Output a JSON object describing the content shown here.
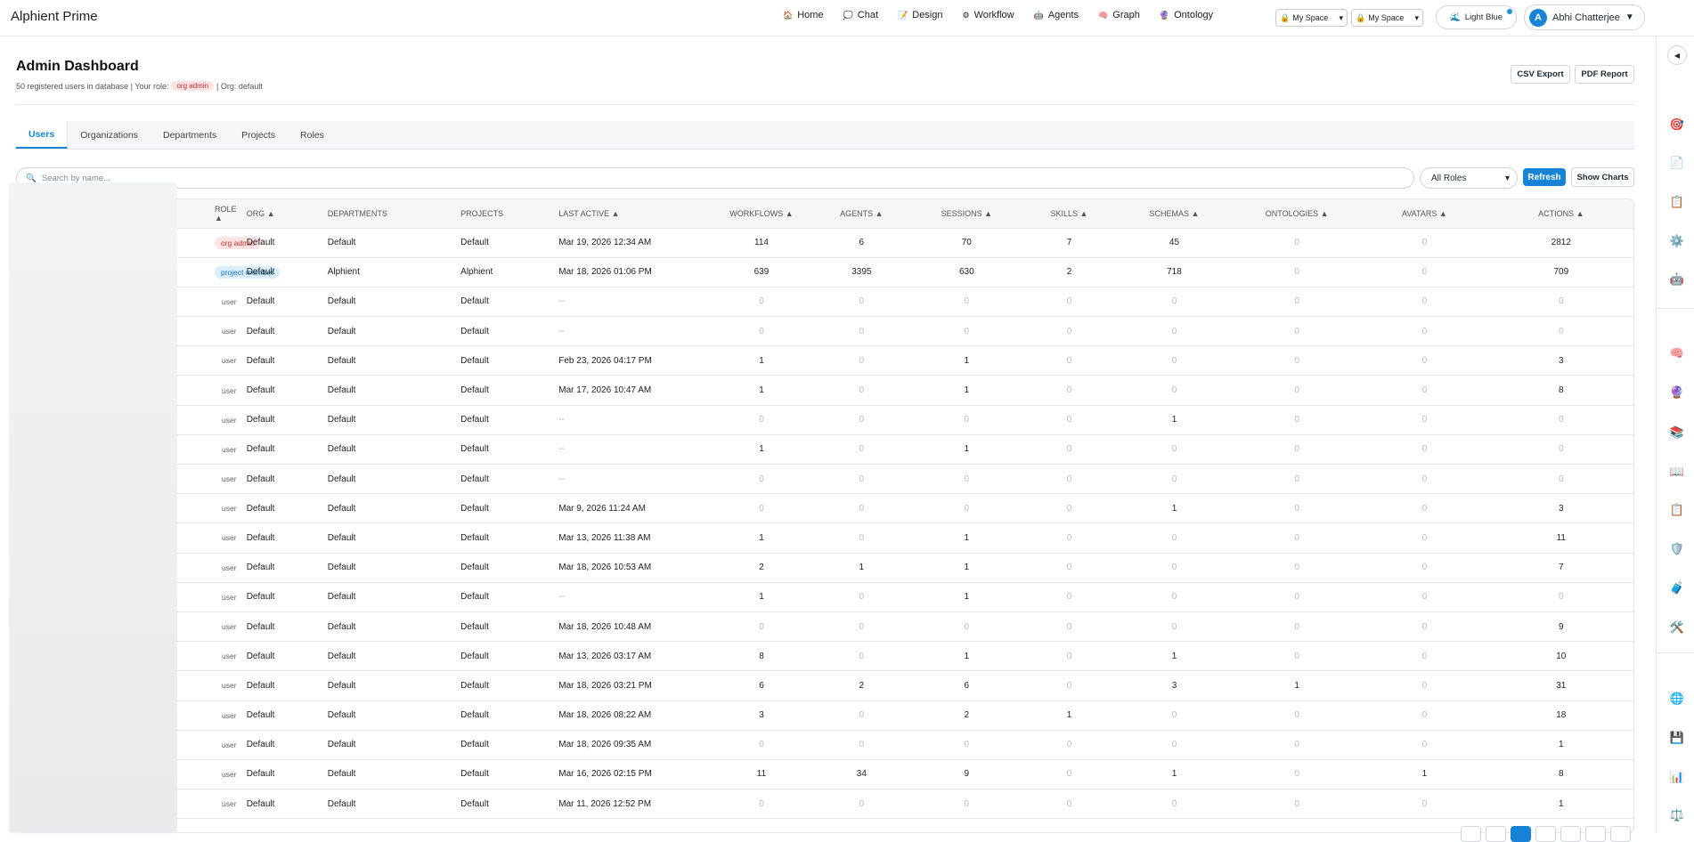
{
  "app": {
    "title": "Alphient Prime"
  },
  "nav": [
    {
      "label": "Home",
      "icon": "🏠"
    },
    {
      "label": "Chat",
      "icon": "💭"
    },
    {
      "label": "Design",
      "icon": "📝"
    },
    {
      "label": "Workflow",
      "icon": "⚙"
    },
    {
      "label": "Agents",
      "icon": "🤖"
    },
    {
      "label": "Graph",
      "icon": "🧠"
    },
    {
      "label": "Ontology",
      "icon": "🔮"
    }
  ],
  "space_selects": [
    {
      "label": "My Space"
    },
    {
      "label": "My Space"
    }
  ],
  "theme": {
    "label": "Light Blue"
  },
  "user": {
    "initial": "A",
    "name": "Abhi Chatterjee"
  },
  "page": {
    "title": "Admin Dashboard",
    "subtitle_prefix": "50 registered users in database | Your role:",
    "role_badge": "org admin",
    "subtitle_suffix": "| Org: default",
    "csv_export": "CSV Export",
    "pdf_report": "PDF Report"
  },
  "tabs": [
    {
      "label": "Users",
      "active": true
    },
    {
      "label": "Organizations"
    },
    {
      "label": "Departments"
    },
    {
      "label": "Projects"
    },
    {
      "label": "Roles"
    }
  ],
  "toolbar": {
    "search_placeholder": "Search by name...",
    "roles_filter": "All Roles",
    "refresh": "Refresh",
    "show_charts": "Show Charts"
  },
  "table": {
    "columns": [
      {
        "label": "ROLE ▲"
      },
      {
        "label": "ORG ▲"
      },
      {
        "label": "DEPARTMENTS"
      },
      {
        "label": "PROJECTS"
      },
      {
        "label": "LAST ACTIVE ▲"
      },
      {
        "label": "WORKFLOWS ▲"
      },
      {
        "label": "AGENTS ▲"
      },
      {
        "label": "SESSIONS ▲"
      },
      {
        "label": "SKILLS ▲"
      },
      {
        "label": "SCHEMAS ▲"
      },
      {
        "label": "ONTOLOGIES ▲"
      },
      {
        "label": "AVATARS ▲"
      },
      {
        "label": "ACTIONS ▲"
      }
    ],
    "rows": [
      [
        "org admin",
        "Default",
        "Default",
        "Default",
        "Mar 19, 2026 12:34 AM",
        "114",
        "6",
        "70",
        "7",
        "45",
        "0",
        "0",
        "2812"
      ],
      [
        "project member",
        "Default",
        "Alphient",
        "Alphient",
        "Mar 18, 2026 01:06 PM",
        "639",
        "3395",
        "630",
        "2",
        "718",
        "0",
        "0",
        "709"
      ],
      [
        "user",
        "Default",
        "Default",
        "Default",
        "--",
        "0",
        "0",
        "0",
        "0",
        "0",
        "0",
        "0",
        "0"
      ],
      [
        "user",
        "Default",
        "Default",
        "Default",
        "--",
        "0",
        "0",
        "0",
        "0",
        "0",
        "0",
        "0",
        "0"
      ],
      [
        "user",
        "Default",
        "Default",
        "Default",
        "Feb 23, 2026 04:17 PM",
        "1",
        "0",
        "1",
        "0",
        "0",
        "0",
        "0",
        "3"
      ],
      [
        "user",
        "Default",
        "Default",
        "Default",
        "Mar 17, 2026 10:47 AM",
        "1",
        "0",
        "1",
        "0",
        "0",
        "0",
        "0",
        "8"
      ],
      [
        "user",
        "Default",
        "Default",
        "Default",
        "--",
        "0",
        "0",
        "0",
        "0",
        "1",
        "0",
        "0",
        "0"
      ],
      [
        "user",
        "Default",
        "Default",
        "Default",
        "--",
        "1",
        "0",
        "1",
        "0",
        "0",
        "0",
        "0",
        "0"
      ],
      [
        "user",
        "Default",
        "Default",
        "Default",
        "--",
        "0",
        "0",
        "0",
        "0",
        "0",
        "0",
        "0",
        "0"
      ],
      [
        "user",
        "Default",
        "Default",
        "Default",
        "Mar 9, 2026 11:24 AM",
        "0",
        "0",
        "0",
        "0",
        "1",
        "0",
        "0",
        "3"
      ],
      [
        "user",
        "Default",
        "Default",
        "Default",
        "Mar 13, 2026 11:38 AM",
        "1",
        "0",
        "1",
        "0",
        "0",
        "0",
        "0",
        "11"
      ],
      [
        "user",
        "Default",
        "Default",
        "Default",
        "Mar 18, 2026 10:53 AM",
        "2",
        "1",
        "1",
        "0",
        "0",
        "0",
        "0",
        "7"
      ],
      [
        "user",
        "Default",
        "Default",
        "Default",
        "--",
        "1",
        "0",
        "1",
        "0",
        "0",
        "0",
        "0",
        "0"
      ],
      [
        "user",
        "Default",
        "Default",
        "Default",
        "Mar 18, 2026 10:48 AM",
        "0",
        "0",
        "0",
        "0",
        "0",
        "0",
        "0",
        "9"
      ],
      [
        "user",
        "Default",
        "Default",
        "Default",
        "Mar 13, 2026 03:17 AM",
        "8",
        "0",
        "1",
        "0",
        "1",
        "0",
        "0",
        "10"
      ],
      [
        "user",
        "Default",
        "Default",
        "Default",
        "Mar 18, 2026 03:21 PM",
        "6",
        "2",
        "6",
        "0",
        "3",
        "1",
        "0",
        "31"
      ],
      [
        "user",
        "Default",
        "Default",
        "Default",
        "Mar 18, 2026 08:22 AM",
        "3",
        "0",
        "2",
        "1",
        "0",
        "0",
        "0",
        "18"
      ],
      [
        "user",
        "Default",
        "Default",
        "Default",
        "Mar 18, 2026 09:35 AM",
        "0",
        "0",
        "0",
        "0",
        "0",
        "0",
        "0",
        "1"
      ],
      [
        "user",
        "Default",
        "Default",
        "Default",
        "Mar 16, 2026 02:15 PM",
        "11",
        "34",
        "9",
        "0",
        "1",
        "0",
        "1",
        "8"
      ],
      [
        "user",
        "Default",
        "Default",
        "Default",
        "Mar 11, 2026 12:52 PM",
        "0",
        "0",
        "0",
        "0",
        "0",
        "0",
        "0",
        "1"
      ]
    ]
  },
  "right_sidebar": {
    "collapse": "◀",
    "icons": [
      "🎯",
      "📄",
      "📋",
      "⚙️",
      "🤖",
      "🧠",
      "🔮",
      "📚",
      "📖",
      "📋",
      "🛡️",
      "🧳",
      "🛠️",
      "🌐",
      "💾",
      "📊",
      "⚖️"
    ]
  },
  "colors": {
    "accent": "#1783d6",
    "org_badge": "#fde2e2",
    "project_badge": "#dbeefc"
  }
}
